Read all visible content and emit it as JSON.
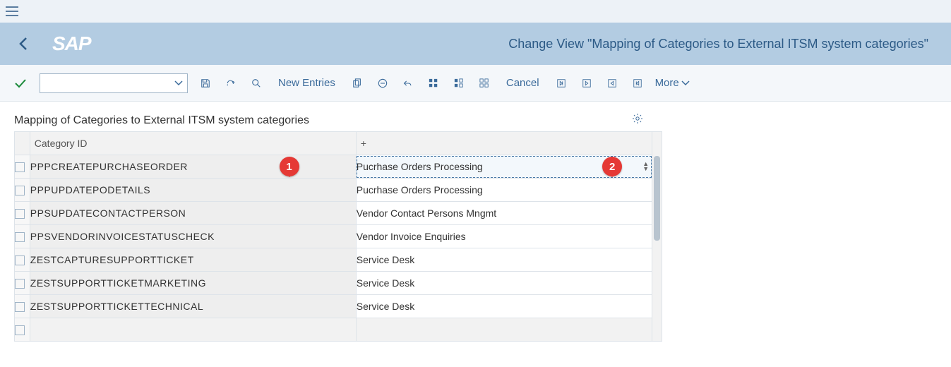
{
  "header": {
    "title": "Change View \"Mapping of Categories to External ITSM system categories\""
  },
  "toolbar": {
    "new_entries": "New Entries",
    "cancel": "Cancel",
    "more": "More"
  },
  "section": {
    "title": "Mapping of Categories to External ITSM system categories"
  },
  "columns": {
    "category_id": "Category ID",
    "plus": "+"
  },
  "callouts": [
    "1",
    "2"
  ],
  "rows": [
    {
      "cat": "PPPCREATEPURCHASEORDER",
      "val": "Pucrhase Orders Processing",
      "selected": true
    },
    {
      "cat": "PPPUPDATEPODETAILS",
      "val": "Pucrhase Orders Processing",
      "selected": false
    },
    {
      "cat": "PPSUPDATECONTACTPERSON",
      "val": "Vendor Contact Persons Mngmt",
      "selected": false
    },
    {
      "cat": "PPSVENDORINVOICESTATUSCHECK",
      "val": "Vendor Invoice Enquiries",
      "selected": false
    },
    {
      "cat": "ZESTCAPTURESUPPORTTICKET",
      "val": "Service Desk",
      "selected": false
    },
    {
      "cat": "ZESTSUPPORTTICKETMARKETING",
      "val": "Service Desk",
      "selected": false
    },
    {
      "cat": "ZESTSUPPORTTICKETTECHNICAL",
      "val": "Service Desk",
      "selected": false
    }
  ]
}
